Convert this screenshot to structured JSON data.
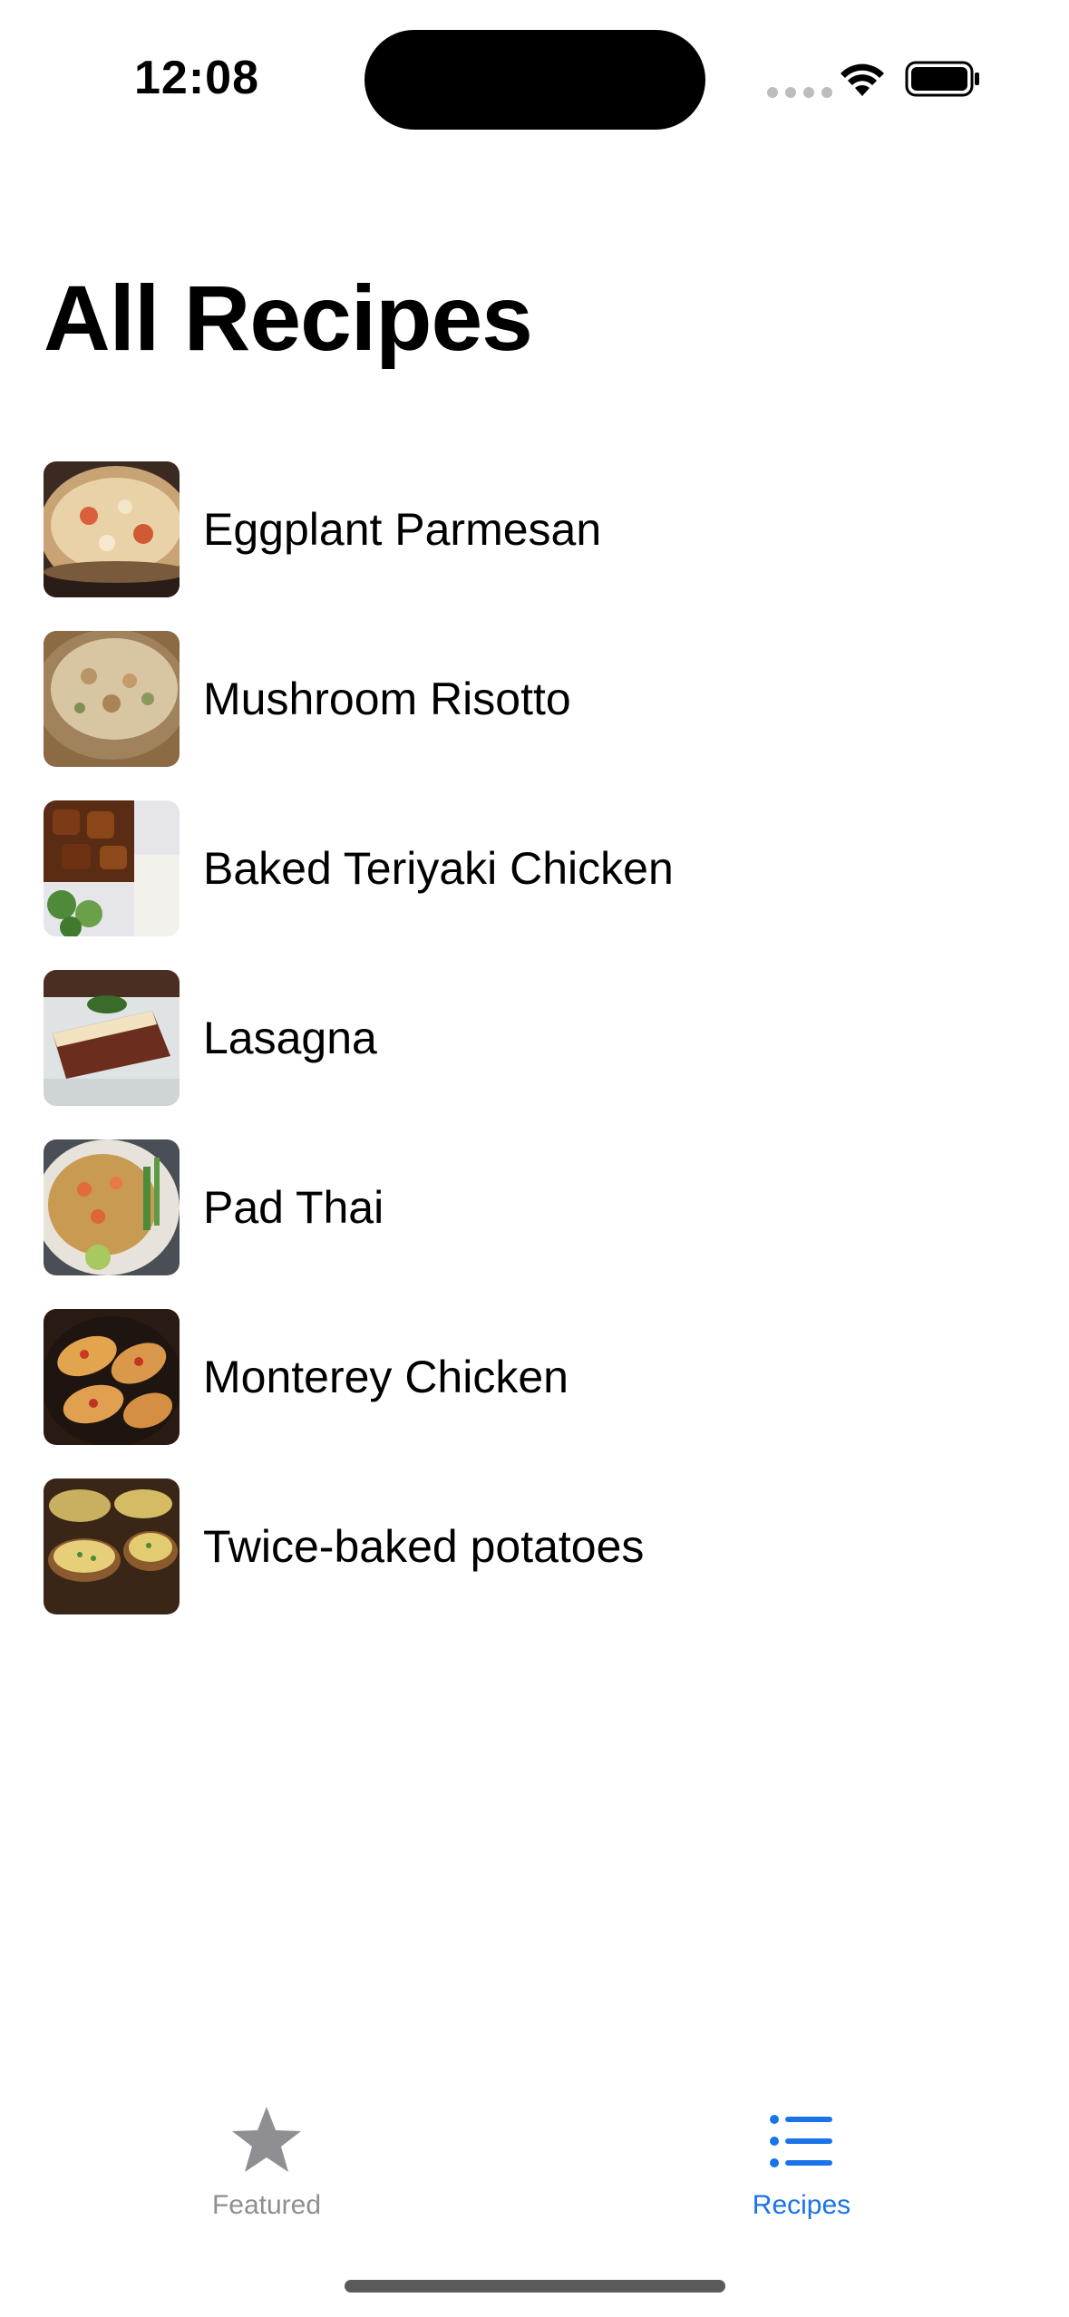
{
  "status_bar": {
    "time": "12:08"
  },
  "title": "All Recipes",
  "recipes": [
    {
      "name": "Eggplant Parmesan",
      "thumb": "eggplant-parmesan-photo"
    },
    {
      "name": "Mushroom Risotto",
      "thumb": "mushroom-risotto-photo"
    },
    {
      "name": "Baked Teriyaki Chicken",
      "thumb": "teriyaki-chicken-photo"
    },
    {
      "name": "Lasagna",
      "thumb": "lasagna-photo"
    },
    {
      "name": "Pad Thai",
      "thumb": "pad-thai-photo"
    },
    {
      "name": "Monterey Chicken",
      "thumb": "monterey-chicken-photo"
    },
    {
      "name": "Twice-baked potatoes",
      "thumb": "twice-baked-potatoes-photo"
    }
  ],
  "tab_bar": {
    "featured": {
      "label": "Featured",
      "icon": "star-icon",
      "selected": false
    },
    "recipes": {
      "label": "Recipes",
      "icon": "list-icon",
      "selected": true
    }
  },
  "colors": {
    "accent": "#1a73e8",
    "inactive": "#8e8e93"
  }
}
